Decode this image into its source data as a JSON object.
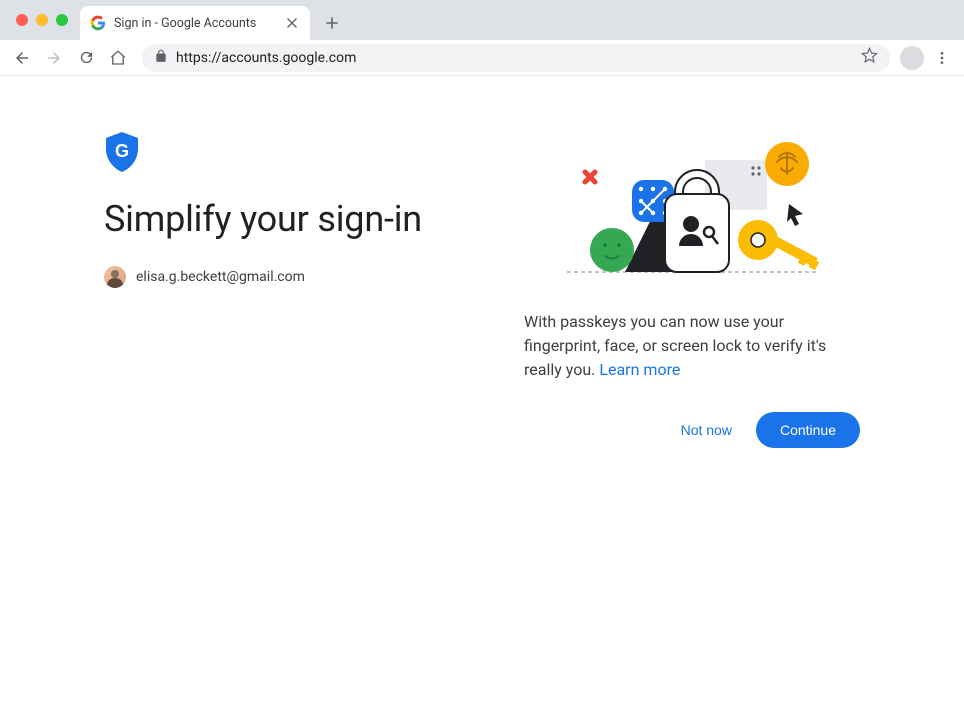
{
  "browser": {
    "tab_title": "Sign in - Google Accounts",
    "url": "https://accounts.google.com"
  },
  "content": {
    "title": "Simplify your sign-in",
    "email": "elisa.g.beckett@gmail.com",
    "description_text": "With passkeys you can now use your fingerprint, face, or screen lock to verify it's really you. ",
    "learn_more": "Learn more",
    "not_now": "Not now",
    "continue": "Continue"
  }
}
